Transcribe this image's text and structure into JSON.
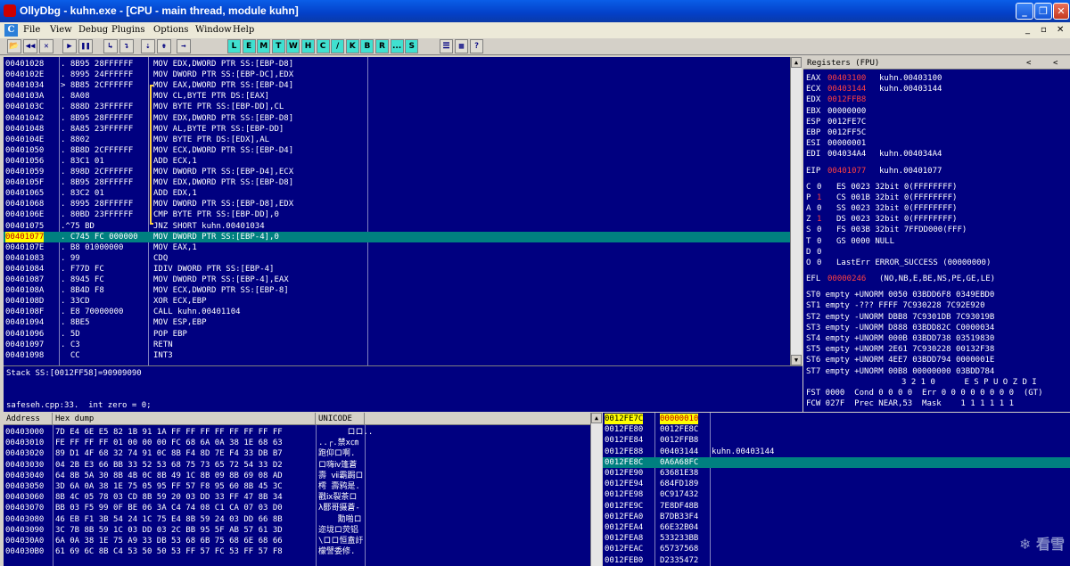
{
  "window": {
    "title": "OllyDbg - kuhn.exe - [CPU - main thread, module kuhn]",
    "minimize": "_",
    "restore": "❐",
    "close": "✕"
  },
  "menu": {
    "app_icon": "C",
    "items": [
      "File",
      "View",
      "Debug",
      "Plugins",
      "Options",
      "Window",
      "Help"
    ],
    "mdi_controls": [
      "_",
      "▫",
      "✕"
    ]
  },
  "toolbar": {
    "buttons": [
      "📂",
      "◀◀",
      "✕",
      "▶",
      "❚❚",
      "↳",
      "↴",
      "⇣",
      "⇟",
      "→"
    ],
    "letters": [
      "L",
      "E",
      "M",
      "T",
      "W",
      "H",
      "C",
      "/",
      "K",
      "B",
      "R",
      "...",
      "S"
    ],
    "extras": [
      "☰",
      "▦",
      "?"
    ]
  },
  "disasm": {
    "rows": [
      {
        "addr": "00401028",
        "hex": ". 8B95 28FFFFFF",
        "asm": "MOV EDX,DWORD PTR SS:[EBP-D8]"
      },
      {
        "addr": "0040102E",
        "hex": ". 8995 24FFFFFF",
        "asm": "MOV DWORD PTR SS:[EBP-DC],EDX"
      },
      {
        "addr": "00401034",
        "hex": "> 8B85 2CFFFFFF",
        "asm": "MOV EAX,DWORD PTR SS:[EBP-D4]"
      },
      {
        "addr": "0040103A",
        "hex": ". 8A08",
        "asm": "MOV CL,BYTE PTR DS:[EAX]"
      },
      {
        "addr": "0040103C",
        "hex": ". 888D 23FFFFFF",
        "asm": "MOV BYTE PTR SS:[EBP-DD],CL"
      },
      {
        "addr": "00401042",
        "hex": ". 8B95 28FFFFFF",
        "asm": "MOV EDX,DWORD PTR SS:[EBP-D8]"
      },
      {
        "addr": "00401048",
        "hex": ". 8A85 23FFFFFF",
        "asm": "MOV AL,BYTE PTR SS:[EBP-DD]"
      },
      {
        "addr": "0040104E",
        "hex": ". 8802",
        "asm": "MOV BYTE PTR DS:[EDX],AL"
      },
      {
        "addr": "00401050",
        "hex": ". 8B8D 2CFFFFFF",
        "asm": "MOV ECX,DWORD PTR SS:[EBP-D4]"
      },
      {
        "addr": "00401056",
        "hex": ". 83C1 01",
        "asm": "ADD ECX,1"
      },
      {
        "addr": "00401059",
        "hex": ". 898D 2CFFFFFF",
        "asm": "MOV DWORD PTR SS:[EBP-D4],ECX"
      },
      {
        "addr": "0040105F",
        "hex": ". 8B95 28FFFFFF",
        "asm": "MOV EDX,DWORD PTR SS:[EBP-D8]"
      },
      {
        "addr": "00401065",
        "hex": ". 83C2 01",
        "asm": "ADD EDX,1"
      },
      {
        "addr": "00401068",
        "hex": ". 8995 28FFFFFF",
        "asm": "MOV DWORD PTR SS:[EBP-D8],EDX"
      },
      {
        "addr": "0040106E",
        "hex": ". 80BD 23FFFFFF",
        "asm": "CMP BYTE PTR SS:[EBP-DD],0"
      },
      {
        "addr": "00401075",
        "hex": ".^75 BD",
        "asm": "JNZ SHORT kuhn.00401034"
      },
      {
        "addr": "00401077",
        "hex": ". C745 FC 000000",
        "asm": "MOV DWORD PTR SS:[EBP-4],0"
      },
      {
        "addr": "0040107E",
        "hex": ". B8 01000000",
        "asm": "MOV EAX,1"
      },
      {
        "addr": "00401083",
        "hex": ". 99",
        "asm": "CDQ"
      },
      {
        "addr": "00401084",
        "hex": ". F77D FC",
        "asm": "IDIV DWORD PTR SS:[EBP-4]"
      },
      {
        "addr": "00401087",
        "hex": ". 8945 FC",
        "asm": "MOV DWORD PTR SS:[EBP-4],EAX"
      },
      {
        "addr": "0040108A",
        "hex": ". 8B4D F8",
        "asm": "MOV ECX,DWORD PTR SS:[EBP-8]"
      },
      {
        "addr": "0040108D",
        "hex": ". 33CD",
        "asm": "XOR ECX,EBP"
      },
      {
        "addr": "0040108F",
        "hex": ". E8 70000000",
        "asm": "CALL kuhn.00401104"
      },
      {
        "addr": "00401094",
        "hex": ". 8BE5",
        "asm": "MOV ESP,EBP"
      },
      {
        "addr": "00401096",
        "hex": ". 5D",
        "asm": "POP EBP"
      },
      {
        "addr": "00401097",
        "hex": ". C3",
        "asm": "RETN"
      },
      {
        "addr": "00401098",
        "hex": "  CC",
        "asm": "INT3"
      }
    ],
    "selected_addr": "00401077"
  },
  "info": {
    "line1": "Stack SS:[0012FF58]=90909090",
    "line2": "safeseh.cpp:33.  int zero = 0;"
  },
  "registers": {
    "title": "Registers (FPU)",
    "arrows": [
      "<",
      "<"
    ],
    "gp": [
      {
        "name": "EAX",
        "value": "00403100",
        "comment": "kuhn.00403100",
        "changed": true
      },
      {
        "name": "ECX",
        "value": "00403144",
        "comment": "kuhn.00403144",
        "changed": true
      },
      {
        "name": "EDX",
        "value": "0012FFB8",
        "comment": "",
        "changed": true
      },
      {
        "name": "EBX",
        "value": "00000000",
        "comment": "",
        "changed": false
      },
      {
        "name": "ESP",
        "value": "0012FE7C",
        "comment": "",
        "changed": false
      },
      {
        "name": "EBP",
        "value": "0012FF5C",
        "comment": "",
        "changed": false
      },
      {
        "name": "ESI",
        "value": "00000001",
        "comment": "",
        "changed": false
      },
      {
        "name": "EDI",
        "value": "004034A4",
        "comment": "kuhn.004034A4",
        "changed": false
      }
    ],
    "eip": {
      "name": "EIP",
      "value": "00401077",
      "comment": "kuhn.00401077"
    },
    "flags": [
      {
        "f": "C",
        "v": "0",
        "seg": "ES 0023 32bit 0(FFFFFFFF)",
        "changed": false
      },
      {
        "f": "P",
        "v": "1",
        "seg": "CS 001B 32bit 0(FFFFFFFF)",
        "changed": true
      },
      {
        "f": "A",
        "v": "0",
        "seg": "SS 0023 32bit 0(FFFFFFFF)",
        "changed": false
      },
      {
        "f": "Z",
        "v": "1",
        "seg": "DS 0023 32bit 0(FFFFFFFF)",
        "changed": true
      },
      {
        "f": "S",
        "v": "0",
        "seg": "FS 003B 32bit 7FFDD000(FFF)",
        "changed": false
      },
      {
        "f": "T",
        "v": "0",
        "seg": "GS 0000 NULL",
        "changed": false
      },
      {
        "f": "D",
        "v": "0",
        "seg": "",
        "changed": false
      },
      {
        "f": "O",
        "v": "0",
        "seg": "LastErr ERROR_SUCCESS (00000000)",
        "changed": false
      }
    ],
    "efl": {
      "name": "EFL",
      "value": "00000246",
      "comment": "(NO,NB,E,BE,NS,PE,GE,LE)"
    },
    "fpu": [
      "ST0 empty +UNORM 0050 03BDD6F8 0349EBD0",
      "ST1 empty -??? FFFF 7C930228 7C92E920",
      "ST2 empty -UNORM DBB8 7C9301DB 7C93019B",
      "ST3 empty -UNORM D888 03BDD82C C0000034",
      "ST4 empty +UNORM 000B 03BDD738 03519830",
      "ST5 empty +UNORM 2E61 7C930228 00132F38",
      "ST6 empty +UNORM 4EE7 03BDD794 0000001E",
      "ST7 empty +UNORM 00B8 00000000 03BDD784"
    ],
    "fpu_bits_header": "3 2 1 0      E S P U O Z D I",
    "fst": "FST 0000  Cond 0 0 0 0  Err 0 0 0 0 0 0 0 0  (GT)",
    "fcw": "FCW 027F  Prec NEAR,53  Mask    1 1 1 1 1 1"
  },
  "dump": {
    "headers": {
      "address": "Address",
      "hex": "Hex dump",
      "unicode": "UNICODE"
    },
    "rows": [
      {
        "addr": "00403000",
        "hex": "7D E4 6E E5 82 1B 91 1A FF FF FF FF FF FF FF FF",
        "uni": "      ロロ.."
      },
      {
        "addr": "00403010",
        "hex": "FE FF FF FF 01 00 00 00 FC 68 6A 0A 38 1E 68 63",
        "uni": "..┌.禁ⅹ㎝"
      },
      {
        "addr": "00403020",
        "hex": "89 D1 4F 68 32 74 91 0C 8B F4 8D 7E F4 33 DB B7",
        "uni": "跑仰ロ啊."
      },
      {
        "addr": "00403030",
        "hex": "04 2B E3 66 BB 33 52 53 68 75 73 65 72 54 33 D2",
        "uni": "ロ嗨ⅳ篷蒼"
      },
      {
        "addr": "00403040",
        "hex": "64 8B 5A 30 8B 4B 0C 8B 49 1C 8B 09 8B 69 08 AD",
        "uni": "壽 ⅶ霸跼ロ"
      },
      {
        "addr": "00403050",
        "hex": "3D 6A 0A 38 1E 75 05 95 FF 57 F8 95 60 8B 45 3C",
        "uni": "樗 壽鸦是."
      },
      {
        "addr": "00403060",
        "hex": "8B 4C 05 78 03 CD 8B 59 20 03 DD 33 FF 47 8B 34",
        "uni": "戳ⅸ裂茶ロ"
      },
      {
        "addr": "00403070",
        "hex": "BB 03 F5 99 0F BE 06 3A C4 74 08 C1 CA 07 03 D0",
        "uni": "λ郾哥摄蒼-"
      },
      {
        "addr": "00403080",
        "hex": "46 EB F1 3B 54 24 1C 75 E4 8B 59 24 03 DD 66 8B",
        "uni": "    勳啪ロ"
      },
      {
        "addr": "00403090",
        "hex": "3C 7B 8B 59 1C 03 DD 03 2C BB 95 5F AB 57 61 3D",
        "uni": "迩垅ロ荧铝"
      },
      {
        "addr": "004030A0",
        "hex": "6A 0A 38 1E 75 A9 33 DB 53 68 6B 75 68 6E 68 66",
        "uni": "\\ロロ恒盍訏"
      },
      {
        "addr": "004030B0",
        "hex": "61 69 6C 8B C4 53 50 50 53 FF 57 FC 53 FF 57 F8",
        "uni": "檬譬委修."
      }
    ]
  },
  "stack": {
    "rows": [
      {
        "addr": "0012FE7C",
        "val": "00000010",
        "comment": "",
        "top": true
      },
      {
        "addr": "0012FE80",
        "val": "0012FE8C",
        "comment": ""
      },
      {
        "addr": "0012FE84",
        "val": "0012FFB8",
        "comment": ""
      },
      {
        "addr": "0012FE88",
        "val": "00403144",
        "comment": "kuhn.00403144"
      },
      {
        "addr": "0012FE8C",
        "val": "0A6A68FC",
        "comment": "",
        "selected": true
      },
      {
        "addr": "0012FE90",
        "val": "63681E38",
        "comment": ""
      },
      {
        "addr": "0012FE94",
        "val": "684FD189",
        "comment": ""
      },
      {
        "addr": "0012FE98",
        "val": "0C917432",
        "comment": ""
      },
      {
        "addr": "0012FE9C",
        "val": "7E8DF48B",
        "comment": ""
      },
      {
        "addr": "0012FEA0",
        "val": "B7DB33F4",
        "comment": ""
      },
      {
        "addr": "0012FEA4",
        "val": "66E32B04",
        "comment": ""
      },
      {
        "addr": "0012FEA8",
        "val": "533233BB",
        "comment": ""
      },
      {
        "addr": "0012FEAC",
        "val": "65737568",
        "comment": ""
      },
      {
        "addr": "0012FEB0",
        "val": "D2335472",
        "comment": ""
      }
    ]
  },
  "watermark": "❄ 看雪"
}
